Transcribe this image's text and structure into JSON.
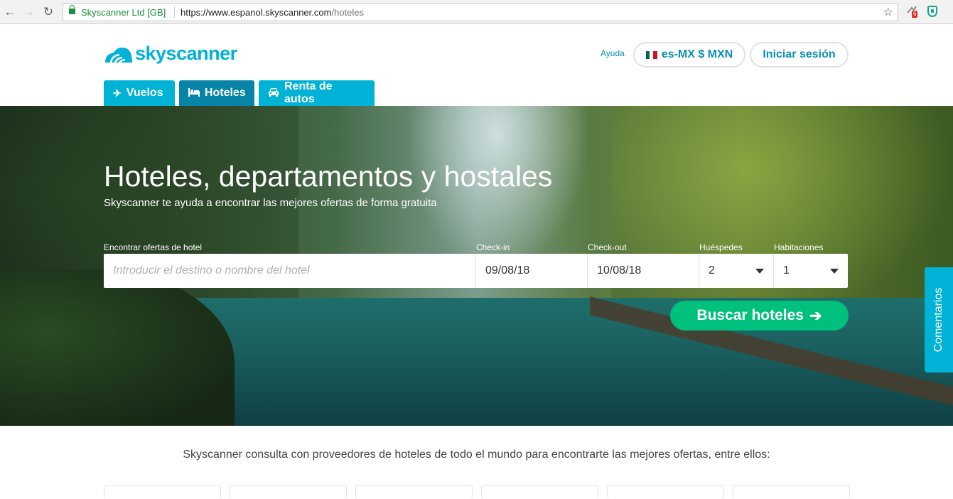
{
  "browser": {
    "back_icon": "←",
    "forward_icon": "→",
    "reload_icon": "↻",
    "site_identity": "Skyscanner Ltd [GB]",
    "url_host": "https://www.espanol.skyscanner.com",
    "url_path": "/hoteles",
    "star_icon": "☆",
    "extension_badge": "6"
  },
  "header": {
    "logo_text": "skyscanner",
    "help_label": "Ayuda",
    "locale_label": "es-MX $ MXN",
    "login_label": "Iniciar sesión",
    "colors": {
      "brand": "#00b2d6",
      "brand_dark": "#0784a8",
      "cta": "#00c07e"
    }
  },
  "tabs": [
    {
      "label": "Vuelos",
      "icon": "plane-icon",
      "glyph": "✈"
    },
    {
      "label": "Hoteles",
      "icon": "bed-icon",
      "glyph": "🛏"
    },
    {
      "label": "Renta de autos",
      "icon": "car-icon",
      "glyph": "🚗"
    }
  ],
  "hero": {
    "title": "Hoteles, departamentos y hostales",
    "subtitle": "Skyscanner te ayuda a encontrar las mejores ofertas de forma gratuita"
  },
  "search": {
    "destination_label": "Encontrar ofertas de hotel",
    "destination_placeholder": "Introducir el destino o nombre del hotel",
    "checkin_label": "Check-in",
    "checkin_value": "09/08/18",
    "checkout_label": "Check-out",
    "checkout_value": "10/08/18",
    "guests_label": "Huéspedes",
    "guests_value": "2",
    "rooms_label": "Habitaciones",
    "rooms_value": "1",
    "submit_label": "Buscar hoteles",
    "submit_arrow": "➔"
  },
  "feedback_label": "Comentarios",
  "providers_text": "Skyscanner consulta con proveedores de hoteles de todo el mundo para encontrarte las mejores ofertas, entre ellos:"
}
